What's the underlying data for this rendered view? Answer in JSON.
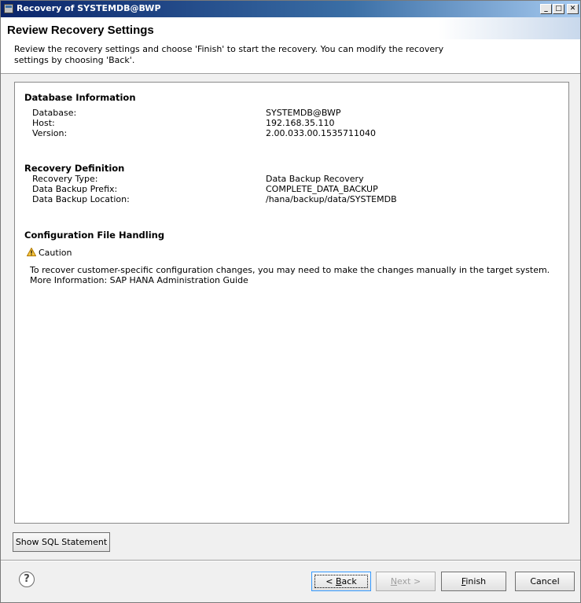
{
  "window": {
    "title": "Recovery of SYSTEMDB@BWP"
  },
  "banner": {
    "title": "Review Recovery Settings",
    "description": "Review the recovery settings and choose 'Finish' to start the recovery. You can modify the recovery settings by choosing 'Back'."
  },
  "database_info": {
    "heading": "Database Information",
    "rows": [
      {
        "label": "Database:",
        "value": "SYSTEMDB@BWP"
      },
      {
        "label": "Host:",
        "value": "192.168.35.110"
      },
      {
        "label": "Version:",
        "value": "2.00.033.00.1535711040"
      }
    ]
  },
  "recovery_definition": {
    "heading": "Recovery Definition",
    "rows": [
      {
        "label": "Recovery Type:",
        "value": "Data Backup Recovery"
      },
      {
        "label": "Data Backup Prefix:",
        "value": "COMPLETE_DATA_BACKUP"
      },
      {
        "label": "Data Backup Location:",
        "value": "/hana/backup/data/SYSTEMDB"
      }
    ]
  },
  "config_handling": {
    "heading": "Configuration File Handling",
    "caution_label": "Caution",
    "caution_icon": "warning-icon",
    "line1": "To recover customer-specific configuration changes, you may need to make the changes manually in the target system.",
    "line2": "More Information: SAP HANA Administration Guide"
  },
  "buttons": {
    "show_sql": "Show SQL Statement",
    "back_prefix": "< ",
    "back_mnemonic": "B",
    "back_rest": "ack",
    "next_mnemonic": "N",
    "next_rest": "ext >",
    "finish_mnemonic": "F",
    "finish_rest": "inish",
    "cancel": "Cancel",
    "help": "?"
  },
  "colors": {
    "titlebar_start": "#0a246a",
    "titlebar_end": "#a6caf0",
    "caution": "#e8a317"
  }
}
